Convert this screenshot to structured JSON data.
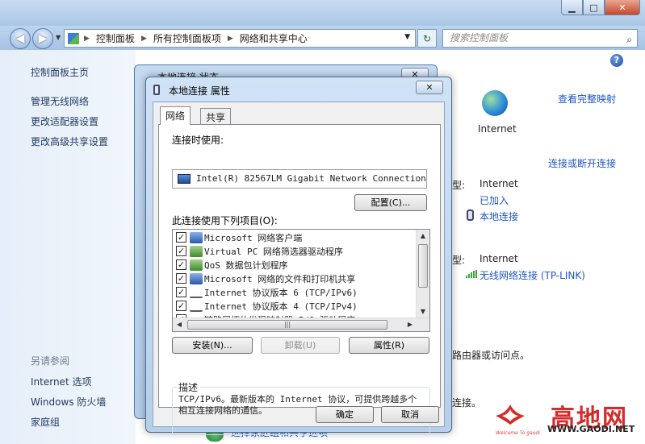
{
  "window": {
    "min_icon": "minimize-icon",
    "max_icon": "maximize-icon",
    "close_icon": "close-icon"
  },
  "address": {
    "crumbs": [
      "控制面板",
      "所有控制面板项",
      "网络和共享中心"
    ],
    "search_placeholder": "搜索控制面板"
  },
  "sidebar": {
    "home": "控制面板主页",
    "links": [
      "管理无线网络",
      "更改适配器设置",
      "更改高级共享设置"
    ],
    "see_also": "另请参阅",
    "see_also_links": [
      "Internet 选项",
      "Windows 防火墙",
      "家庭组"
    ]
  },
  "main": {
    "view_full_map": "查看完整映射",
    "internet_label": "Internet",
    "connect_disconnect": "连接或断开连接",
    "type_suffix_1": "型:",
    "access_type_1": "Internet",
    "joined": "已加入",
    "local_connection": "本地连接",
    "type_suffix_2": "型:",
    "access_type_2": "Internet",
    "wireless_connection": "无线网络连接 (TP-LINK)",
    "router_text": "路由器或访问点。",
    "connect_text": "连接。",
    "bottom_link": "选择家庭组和共享选项"
  },
  "status_dialog": {
    "title": "本地连接 状态"
  },
  "prop_dialog": {
    "title": "本地连接 属性",
    "tabs": [
      "网络",
      "共享"
    ],
    "connect_using_label": "连接时使用:",
    "adapter_name": "Intel(R) 82567LM Gigabit Network Connection",
    "configure_btn": "配置(C)...",
    "items_label": "此连接使用下列项目(O):",
    "items": [
      {
        "label": "Microsoft 网络客户端",
        "checked": true,
        "icon": "network-client-icon"
      },
      {
        "label": "Virtual PC 网络筛选器驱动程序",
        "checked": true,
        "icon": "network-service-icon"
      },
      {
        "label": "QoS 数据包计划程序",
        "checked": true,
        "icon": "network-service-icon"
      },
      {
        "label": "Microsoft 网络的文件和打印机共享",
        "checked": true,
        "icon": "network-client-icon"
      },
      {
        "label": "Internet 协议版本 6 (TCP/IPv6)",
        "checked": true,
        "icon": "protocol-icon"
      },
      {
        "label": "Internet 协议版本 4 (TCP/IPv4)",
        "checked": true,
        "icon": "protocol-icon"
      },
      {
        "label": "链路层拓扑发现映射器 I/O 驱动程序",
        "checked": true,
        "icon": "protocol-icon"
      }
    ],
    "install_btn": "安装(N)...",
    "uninstall_btn": "卸载(U)",
    "properties_btn": "属性(R)",
    "description_label": "描述",
    "description_text": "TCP/IPv6。最新版本的 Internet 协议，可提供跨越多个相互连接网络的通信。",
    "ok_btn": "确定",
    "cancel_btn": "取消"
  },
  "watermark": {
    "brand": "高地网",
    "url": "WWW.GAODI.NET",
    "tagline": "Welcome To gaodi"
  }
}
